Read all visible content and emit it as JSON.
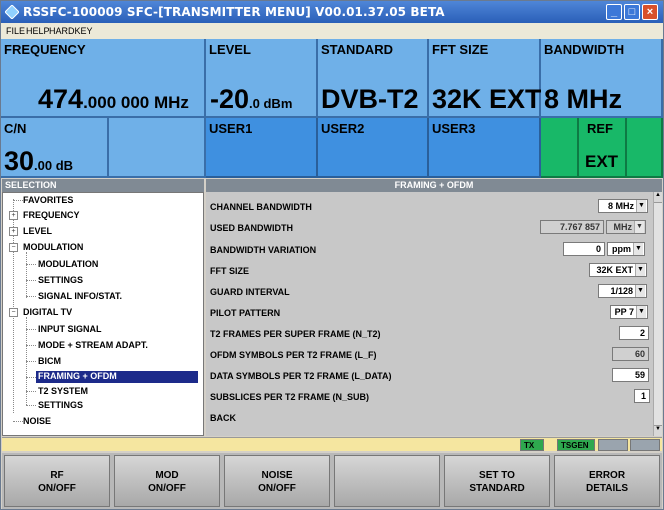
{
  "window": {
    "title": "RSSFC-100009  SFC-[TRANSMITTER MENU]  V00.01.37.05 BETA"
  },
  "menu": {
    "file": "FILE",
    "help": "HELP",
    "hardkey": "HARDKEY"
  },
  "header": {
    "frequency": {
      "label": "FREQUENCY",
      "value_main": "474",
      "value_fine": ".000 000 MHz"
    },
    "level": {
      "label": "LEVEL",
      "value_main": "-20",
      "value_fine": ".0 dBm"
    },
    "standard": {
      "label": "STANDARD",
      "value": "DVB-T2"
    },
    "fft_size": {
      "label": "FFT SIZE",
      "value": "32K EXT"
    },
    "bandwidth": {
      "label": "BANDWIDTH",
      "value": "8 MHz"
    },
    "cn": {
      "label": "C/N",
      "value_main": "30",
      "value_fine": ".00 dB"
    },
    "user1": "USER1",
    "user2": "USER2",
    "user3": "USER3",
    "ref": {
      "label": "REF",
      "value": "EXT"
    }
  },
  "selection": {
    "title": "SELECTION",
    "tree": [
      "FAVORITES",
      "FREQUENCY",
      "LEVEL",
      "MODULATION",
      "MODULATION",
      "SETTINGS",
      "SIGNAL INFO/STAT.",
      "DIGITAL TV",
      "INPUT SIGNAL",
      "MODE + STREAM ADAPT.",
      "BICM",
      "FRAMING + OFDM",
      "T2 SYSTEM",
      "SETTINGS",
      "NOISE"
    ]
  },
  "panel": {
    "title": "FRAMING + OFDM",
    "rows": {
      "channel_bandwidth": {
        "label": "CHANNEL BANDWIDTH",
        "value": "8 MHz"
      },
      "used_bandwidth": {
        "label": "USED BANDWIDTH",
        "value": "7.767 857",
        "unit": "MHz"
      },
      "bandwidth_variation": {
        "label": "BANDWIDTH VARIATION",
        "value": "0",
        "unit": "ppm"
      },
      "fft_size": {
        "label": "FFT SIZE",
        "value": "32K EXT"
      },
      "guard_interval": {
        "label": "GUARD INTERVAL",
        "value": "1/128"
      },
      "pilot_pattern": {
        "label": "PILOT PATTERN",
        "value": "PP 7"
      },
      "t2_frames": {
        "label": "T2 FRAMES PER SUPER FRAME (N_T2)",
        "value": "2"
      },
      "ofdm_symbols": {
        "label": "OFDM SYMBOLS PER T2 FRAME (L_F)",
        "value": "60"
      },
      "data_symbols": {
        "label": "DATA SYMBOLS PER T2 FRAME (L_DATA)",
        "value": "59"
      },
      "subslices": {
        "label": "SUBSLICES PER T2 FRAME (N_SUB)",
        "value": "1"
      },
      "back": {
        "label": "BACK"
      }
    }
  },
  "statusbar": {
    "tx": "TX",
    "tsgen": "TSGEN"
  },
  "softkeys": {
    "rf": {
      "l1": "RF",
      "l2": "ON/OFF"
    },
    "mod": {
      "l1": "MOD",
      "l2": "ON/OFF"
    },
    "noise": {
      "l1": "NOISE",
      "l2": "ON/OFF"
    },
    "set_std": {
      "l1": "SET TO",
      "l2": "STANDARD"
    },
    "error": {
      "l1": "ERROR",
      "l2": "DETAILS"
    }
  },
  "colors": {
    "header_blue": "#6fb0e8",
    "user_blue": "#3f90e0",
    "ref_green": "#18b868",
    "selected": "#1c2a8a",
    "status_yellow": "#f5e6a0"
  }
}
